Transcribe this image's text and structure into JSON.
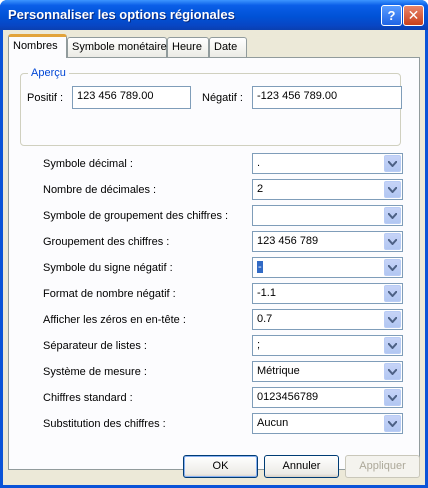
{
  "window": {
    "title": "Personnaliser les options régionales"
  },
  "title_buttons": {
    "help": "?",
    "close": "✕"
  },
  "tabs": [
    {
      "label": "Nombres"
    },
    {
      "label": "Symbole monétaire"
    },
    {
      "label": "Heure"
    },
    {
      "label": "Date"
    }
  ],
  "preview": {
    "group_label": "Aperçu",
    "positive_label": "Positif :",
    "positive_value": "123 456 789.00",
    "negative_label": "Négatif :",
    "negative_value": "-123 456 789.00"
  },
  "settings": [
    {
      "label": "Symbole décimal :",
      "value": "."
    },
    {
      "label": "Nombre de décimales :",
      "value": "2"
    },
    {
      "label": "Symbole de groupement des chiffres :",
      "value": ""
    },
    {
      "label": "Groupement des chiffres :",
      "value": "123 456 789"
    },
    {
      "label": "Symbole du signe négatif :",
      "value": "-"
    },
    {
      "label": "Format de nombre négatif :",
      "value": "-1.1"
    },
    {
      "label": "Afficher les zéros en en-tête :",
      "value": "0.7"
    },
    {
      "label": "Séparateur de listes :",
      "value": ";"
    },
    {
      "label": "Système de mesure :",
      "value": "Métrique"
    },
    {
      "label": "Chiffres standard :",
      "value": "0123456789"
    },
    {
      "label": "Substitution des chiffres :",
      "value": "Aucun"
    }
  ],
  "buttons": {
    "ok": "OK",
    "cancel": "Annuler",
    "apply": "Appliquer"
  },
  "colors": {
    "titlebar": "#0052d6",
    "dialog_bg": "#ece9d8",
    "selection": "#316ac5"
  }
}
